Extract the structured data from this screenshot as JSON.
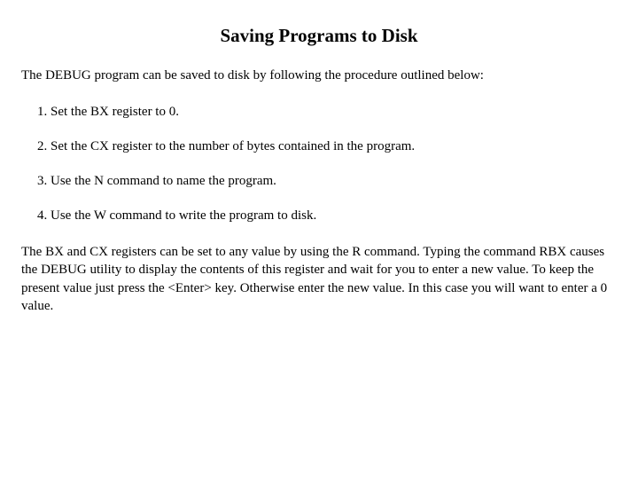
{
  "title": "Saving Programs to Disk",
  "intro": "The DEBUG program can be saved to disk by following the procedure outlined below:",
  "steps": [
    "1. Set the BX register to 0.",
    "2. Set the CX register to the number of bytes contained in the program.",
    "3. Use the N command to name the program.",
    "4. Use the W command to write the program to disk."
  ],
  "closing": "The BX and CX registers can be set to any value by using the R command.  Typing the command RBX causes the DEBUG utility to display the contents of this register and wait for you to enter a new value.  To keep the present value just press the <Enter> key.  Otherwise enter the new value.  In this case you will want to enter a 0 value."
}
